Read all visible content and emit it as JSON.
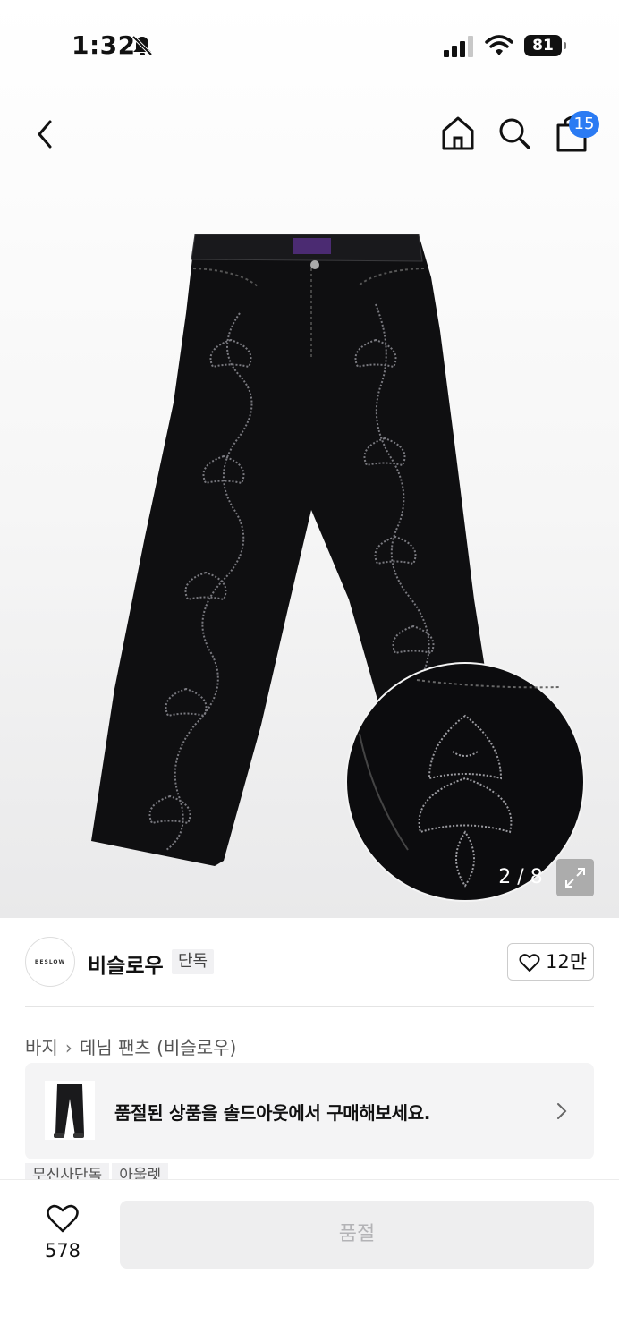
{
  "status_bar": {
    "time": "1:32",
    "battery": "81",
    "icons": [
      "bell-slash-icon",
      "cellular-signal-icon",
      "wifi-icon",
      "battery-icon"
    ]
  },
  "nav": {
    "icons": [
      "back-chevron-icon",
      "home-icon",
      "search-icon",
      "shopping-bag-icon"
    ],
    "cart_count": "15"
  },
  "gallery": {
    "page_indicator": "2 / 8",
    "current_image": 2,
    "total_images": 8,
    "expand_icon": "expand-icon"
  },
  "brand": {
    "logo_text": "BESLOW",
    "name": "비슬로우",
    "tag": "단독",
    "like_count": "12만"
  },
  "breadcrumb": {
    "items": [
      "바지",
      "데님 팬츠 (비슬로우)"
    ]
  },
  "sold_banner": {
    "text": "품절된 상품을 솔드아웃에서 구매해보세요."
  },
  "tags": [
    "무신사단독",
    "아울렛"
  ],
  "bottom_bar": {
    "wish_count": "578",
    "buy_label": "품절"
  },
  "colors": {
    "accent_badge": "#2b7bf3",
    "disabled_button_bg": "#eeeeef",
    "disabled_button_text": "#b3b3b6"
  }
}
